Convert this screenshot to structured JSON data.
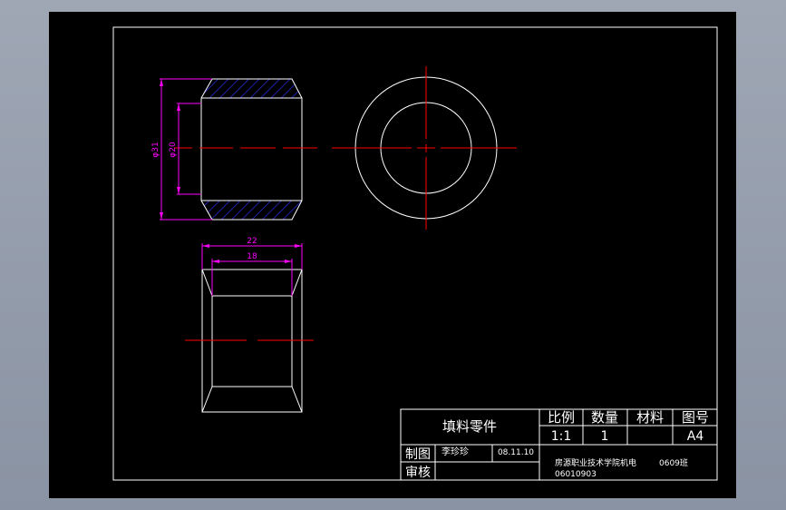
{
  "colors": {
    "background": "#000000",
    "outline": "#ffffff",
    "centerline": "#ff0000",
    "dimension": "#ff00ff",
    "hatch": "#3030ff"
  },
  "drawing": {
    "dim_outer_diameter": "φ31",
    "dim_inner_diameter": "φ20",
    "dim_length_outer": "22",
    "dim_length_inner": "18"
  },
  "title_block": {
    "part_name": "填料零件",
    "scale_label": "比例",
    "scale_value": "1:1",
    "qty_label": "数量",
    "qty_value": "1",
    "material_label": "材料",
    "material_value": "",
    "drawing_no_label": "图号",
    "drawing_no_value": "A4",
    "drawn_label": "制图",
    "drawn_name": "李珍珍",
    "drawn_date": "08.11.10",
    "checked_label": "审核",
    "school": "房源职业技术学院机电",
    "class": "0609班",
    "student_id": "06010903"
  }
}
